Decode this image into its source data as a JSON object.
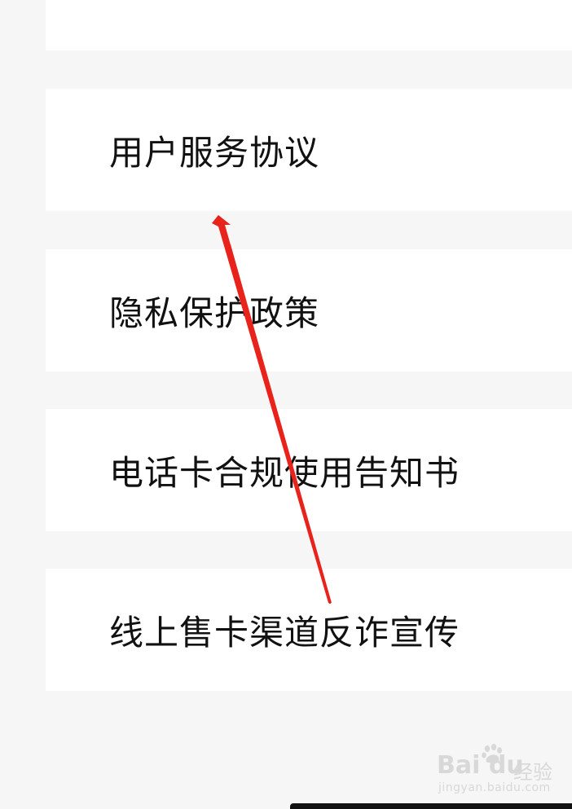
{
  "menu": {
    "items": [
      {
        "label": "用户服务协议"
      },
      {
        "label": "隐私保护政策"
      },
      {
        "label": "电话卡合规使用告知书"
      },
      {
        "label": "线上售卡渠道反诈宣传"
      }
    ]
  },
  "annotation": {
    "arrow_color": "#e8231b"
  },
  "watermark": {
    "logo_text": "Bai du",
    "cn_text": "经验",
    "url_text": "jingyan.baidu.com"
  },
  "colors": {
    "background": "#f6f6f6",
    "card": "#ffffff",
    "text": "#111111"
  }
}
